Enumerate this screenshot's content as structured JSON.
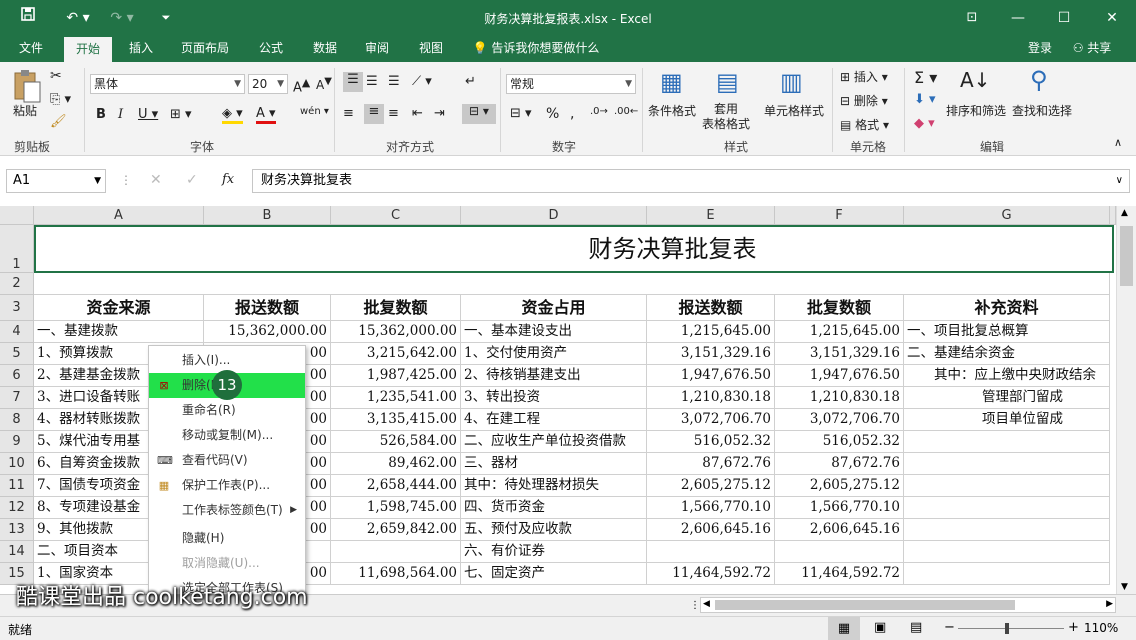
{
  "window": {
    "title": "财务决算批复报表.xlsx - Excel"
  },
  "tabs": [
    "文件",
    "开始",
    "插入",
    "页面布局",
    "公式",
    "数据",
    "审阅",
    "视图"
  ],
  "tellme": "告诉我你想要做什么",
  "account": {
    "login": "登录",
    "share": "共享"
  },
  "ribbon": {
    "clipboard": {
      "paste": "粘贴",
      "label": "剪贴板"
    },
    "font": {
      "name": "黑体",
      "size": "20",
      "label": "字体"
    },
    "align": {
      "label": "对齐方式"
    },
    "number": {
      "format": "常规",
      "label": "数字"
    },
    "styles": {
      "cond": "条件格式",
      "table": "套用\n表格格式",
      "cell": "单元格样式",
      "label": "样式"
    },
    "cells": {
      "insert": "插入",
      "delete": "删除",
      "format": "格式",
      "label": "单元格"
    },
    "editing": {
      "sort": "排序和筛选",
      "find": "查找和选择",
      "label": "编辑"
    }
  },
  "formula_bar": {
    "cell_ref": "A1",
    "content": "财务决算批复表"
  },
  "columns": [
    "A",
    "B",
    "C",
    "D",
    "E",
    "F",
    "G"
  ],
  "rows": [
    "1",
    "2",
    "3",
    "4",
    "5",
    "6",
    "7",
    "8",
    "9",
    "10",
    "11",
    "12",
    "13",
    "14",
    "15"
  ],
  "sheet": {
    "title": "财务决算批复表",
    "headers": [
      "资金来源",
      "报送数额",
      "批复数额",
      "资金占用",
      "报送数额",
      "批复数额",
      "补充资料"
    ],
    "data": [
      [
        "一、基建拨款",
        "15,362,000.00",
        "15,362,000.00",
        "一、基本建设支出",
        "1,215,645.00",
        "1,215,645.00",
        "一、项目批复总概算"
      ],
      [
        "1、预算拨款",
        "00",
        "3,215,642.00",
        "1、交付使用资产",
        "3,151,329.16",
        "3,151,329.16",
        "二、基建结余资金"
      ],
      [
        "2、基建基金拨款",
        "00",
        "1,987,425.00",
        "2、待核销基建支出",
        "1,947,676.50",
        "1,947,676.50",
        "其中：应上缴中央财政结余"
      ],
      [
        "3、进口设备转账",
        "00",
        "1,235,541.00",
        "3、转出投资",
        "1,210,830.18",
        "1,210,830.18",
        "管理部门留成"
      ],
      [
        "4、器材转账拨款",
        "00",
        "3,135,415.00",
        "4、在建工程",
        "3,072,706.70",
        "3,072,706.70",
        "项目单位留成"
      ],
      [
        "5、煤代油专用基",
        "00",
        "526,584.00",
        "二、应收生产单位投资借款",
        "516,052.32",
        "516,052.32",
        ""
      ],
      [
        "6、自筹资金拨款",
        "00",
        "89,462.00",
        "三、器材",
        "87,672.76",
        "87,672.76",
        ""
      ],
      [
        "7、国债专项资金",
        "00",
        "2,658,444.00",
        "其中：待处理器材损失",
        "2,605,275.12",
        "2,605,275.12",
        ""
      ],
      [
        "8、专项建设基金",
        "00",
        "1,598,745.00",
        "四、货币资金",
        "1,566,770.10",
        "1,566,770.10",
        ""
      ],
      [
        "9、其他拨款",
        "00",
        "2,659,842.00",
        "五、预付及应收款",
        "2,606,645.16",
        "2,606,645.16",
        ""
      ],
      [
        "二、项目资本",
        "",
        "",
        "六、有价证券",
        "",
        "",
        ""
      ],
      [
        "1、国家资本",
        "00",
        "11,698,564.00",
        "七、固定资产",
        "11,464,592.72",
        "11,464,592.72",
        ""
      ]
    ]
  },
  "context_menu": {
    "items": [
      {
        "label": "插入(I)...",
        "disabled": false
      },
      {
        "label": "删除(D)",
        "disabled": false,
        "highlight": true
      },
      {
        "label": "重命名(R)",
        "disabled": false
      },
      {
        "label": "移动或复制(M)...",
        "disabled": false
      },
      {
        "label": "查看代码(V)",
        "disabled": false
      },
      {
        "label": "保护工作表(P)...",
        "disabled": false
      },
      {
        "label": "工作表标签颜色(T)",
        "disabled": false
      },
      {
        "label": "隐藏(H)",
        "disabled": false
      },
      {
        "label": "取消隐藏(U)...",
        "disabled": true
      },
      {
        "label": "选定全部工作表(S)",
        "disabled": false
      }
    ],
    "step_badge": "13"
  },
  "status": {
    "text": "就绪",
    "zoom": "110%"
  },
  "watermark": "酷课堂出品 coolketang.com"
}
